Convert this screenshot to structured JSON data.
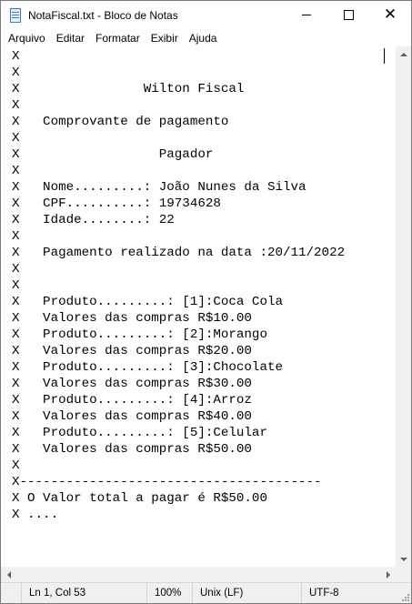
{
  "window": {
    "title": "NotaFiscal.txt - Bloco de Notas",
    "icon": "notepad-icon",
    "controls": {
      "minimize_icon": "minimize-icon",
      "maximize_icon": "maximize-icon",
      "close_icon": "close-icon"
    }
  },
  "menu": {
    "items": [
      "Arquivo",
      "Editar",
      "Formatar",
      "Exibir",
      "Ajuda"
    ]
  },
  "editor": {
    "lines": [
      "X",
      "X",
      "X                Wilton Fiscal",
      "X",
      "X   Comprovante de pagamento",
      "X",
      "X                  Pagador",
      "X",
      "X   Nome.........: João Nunes da Silva",
      "X   CPF..........: 19734628",
      "X   Idade........: 22",
      "X",
      "X   Pagamento realizado na data :20/11/2022",
      "X",
      "X",
      "X   Produto.........: [1]:Coca Cola",
      "X   Valores das compras R$10.00",
      "X   Produto.........: [2]:Morango",
      "X   Valores das compras R$20.00",
      "X   Produto.........: [3]:Chocolate",
      "X   Valores das compras R$30.00",
      "X   Produto.........: [4]:Arroz",
      "X   Valores das compras R$40.00",
      "X   Produto.........: [5]:Celular",
      "X   Valores das compras R$50.00",
      "X",
      "X---------------------------------------",
      "X O Valor total a pagar é R$50.00",
      "X ...."
    ]
  },
  "statusbar": {
    "position": "Ln 1, Col 53",
    "zoom": "100%",
    "line_ending": "Unix (LF)",
    "encoding": "UTF-8"
  },
  "colors": {
    "chrome_background": "#f0f0f0",
    "editor_background": "#ffffff",
    "text": "#000000",
    "border": "#7a7a7a"
  }
}
